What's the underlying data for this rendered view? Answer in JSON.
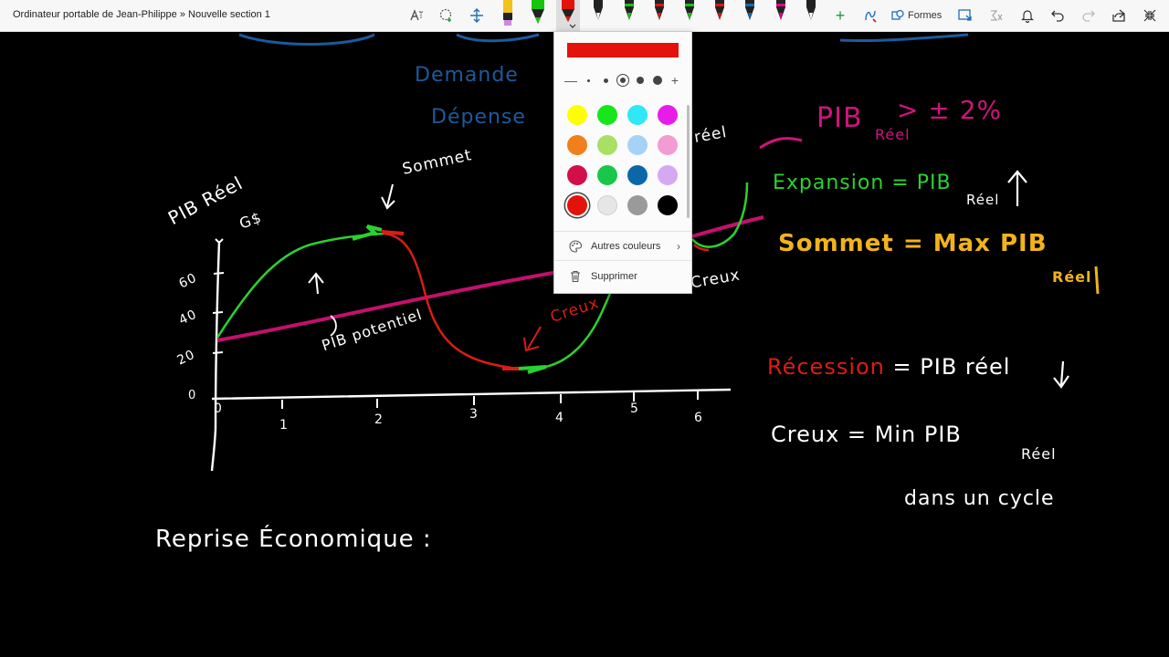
{
  "window": {
    "title": "Ordinateur portable de Jean-Philippe » Nouvelle section 1"
  },
  "toolbar": {
    "shapes_label": "Formes",
    "pen_colors": [
      "#1a1a1a",
      "#16c60c",
      "#e3120b",
      "#1a1a1a",
      "#16c60c",
      "#e3120b",
      "#16c60c",
      "#e3120b",
      "#1a1a1a",
      "#0f6cbd",
      "#e3008c",
      "#1a1a1a"
    ],
    "highlighter_color": "#cf85e6",
    "add_pen_symbol": "+"
  },
  "color_picker": {
    "current_color": "#e3120b",
    "size_decrease_symbol": "—",
    "size_increase_symbol": "+",
    "swatches": [
      "#ffff00",
      "#16e61a",
      "#2ee8f5",
      "#e81ce8",
      "#f07f1c",
      "#a8e064",
      "#a6d2f7",
      "#f39bd3",
      "#d20f4a",
      "#19c74a",
      "#0b67a8",
      "#d6a8f2",
      "#e3120b",
      "#e6e6e6",
      "#9a9a9a",
      "#000000"
    ],
    "more_colors_label": "Autres couleurs",
    "delete_label": "Supprimer"
  },
  "notes": {
    "axis_y_label": "PIB Réel",
    "axis_y_unit": "G$",
    "y_ticks": [
      "60",
      "40",
      "20",
      "0"
    ],
    "x_ticks": [
      "0",
      "1",
      "2",
      "3",
      "4",
      "5",
      "6"
    ],
    "sommet_label": "Sommet",
    "creux_label": "Creux",
    "creux_label_right": "Creux",
    "reel_fragment": "réel",
    "pib_potentiel": "PIB potentiel",
    "top_blue_1": "Demande",
    "top_blue_2": "Dépense",
    "pink_note": "PIB",
    "pink_note_sub": "Réel",
    "pink_note_value": "> ± 2%",
    "expansion_def": "Expansion = PIB",
    "expansion_sub": "Réel",
    "sommet_def": "Sommet = Max PIB",
    "sommet_sub": "Réel",
    "recession_word": "Récession",
    "recession_rest": "= PIB réel",
    "creux_def": "Creux = Min PIB",
    "creux_sub": "Réel",
    "creux_def_line2": "dans un cycle",
    "reprise": "Reprise Économique :"
  }
}
